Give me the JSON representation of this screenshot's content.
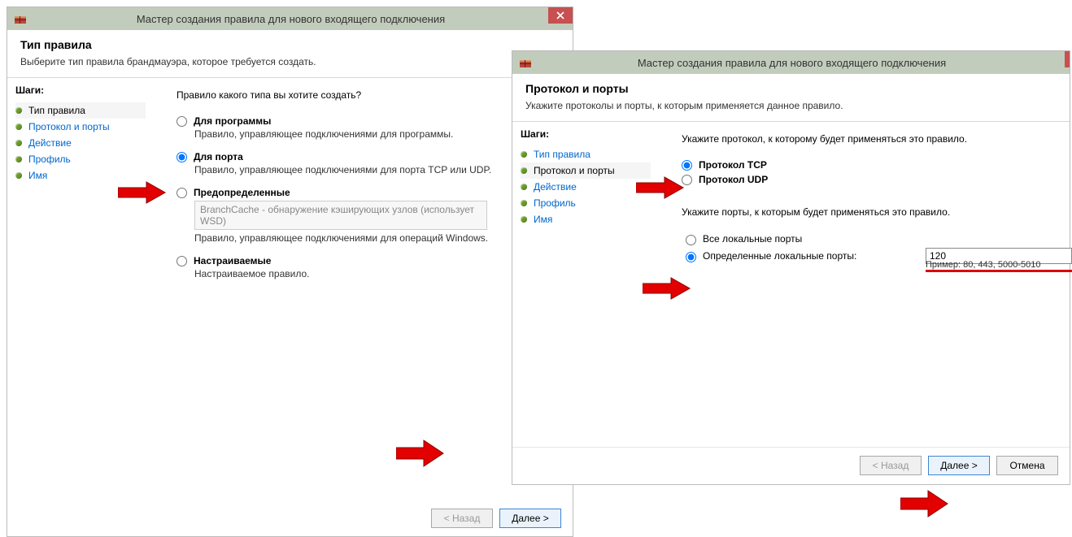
{
  "dialog1": {
    "title": "Мастер создания правила для нового входящего подключения",
    "header": {
      "title": "Тип правила",
      "subtitle": "Выберите тип правила брандмауэра, которое требуется создать."
    },
    "steps_label": "Шаги:",
    "steps": [
      {
        "label": "Тип правила"
      },
      {
        "label": "Протокол и порты"
      },
      {
        "label": "Действие"
      },
      {
        "label": "Профиль"
      },
      {
        "label": "Имя"
      }
    ],
    "prompt": "Правило какого типа вы хотите создать?",
    "options": {
      "program": {
        "label": "Для программы",
        "desc": "Правило, управляющее подключениями для программы."
      },
      "port": {
        "label": "Для порта",
        "desc": "Правило, управляющее подключениями для порта TCP или UDP."
      },
      "predef": {
        "label": "Предопределенные",
        "select": "BranchCache - обнаружение кэширующих узлов (использует WSD)",
        "desc": "Правило, управляющее подключениями для операций Windows."
      },
      "custom": {
        "label": "Настраиваемые",
        "desc": "Настраиваемое правило."
      }
    },
    "buttons": {
      "back": "< Назад",
      "next": "Далее >"
    }
  },
  "dialog2": {
    "title": "Мастер создания правила для нового входящего подключения",
    "header": {
      "title": "Протокол и порты",
      "subtitle": "Укажите протоколы и порты, к которым применяется данное правило."
    },
    "steps_label": "Шаги:",
    "steps": [
      {
        "label": "Тип правила"
      },
      {
        "label": "Протокол и порты"
      },
      {
        "label": "Действие"
      },
      {
        "label": "Профиль"
      },
      {
        "label": "Имя"
      }
    ],
    "prompt_protocol": "Укажите протокол, к которому будет применяться это правило.",
    "protocols": {
      "tcp": "Протокол TCP",
      "udp": "Протокол UDP"
    },
    "prompt_ports": "Укажите порты, к которым будет применяться это правило.",
    "ports": {
      "all": "Все локальные порты",
      "specific": "Определенные локальные порты:",
      "value": "120",
      "example": "Пример: 80, 443, 5000-5010"
    },
    "buttons": {
      "back": "< Назад",
      "next": "Далее >",
      "cancel": "Отмена"
    }
  }
}
